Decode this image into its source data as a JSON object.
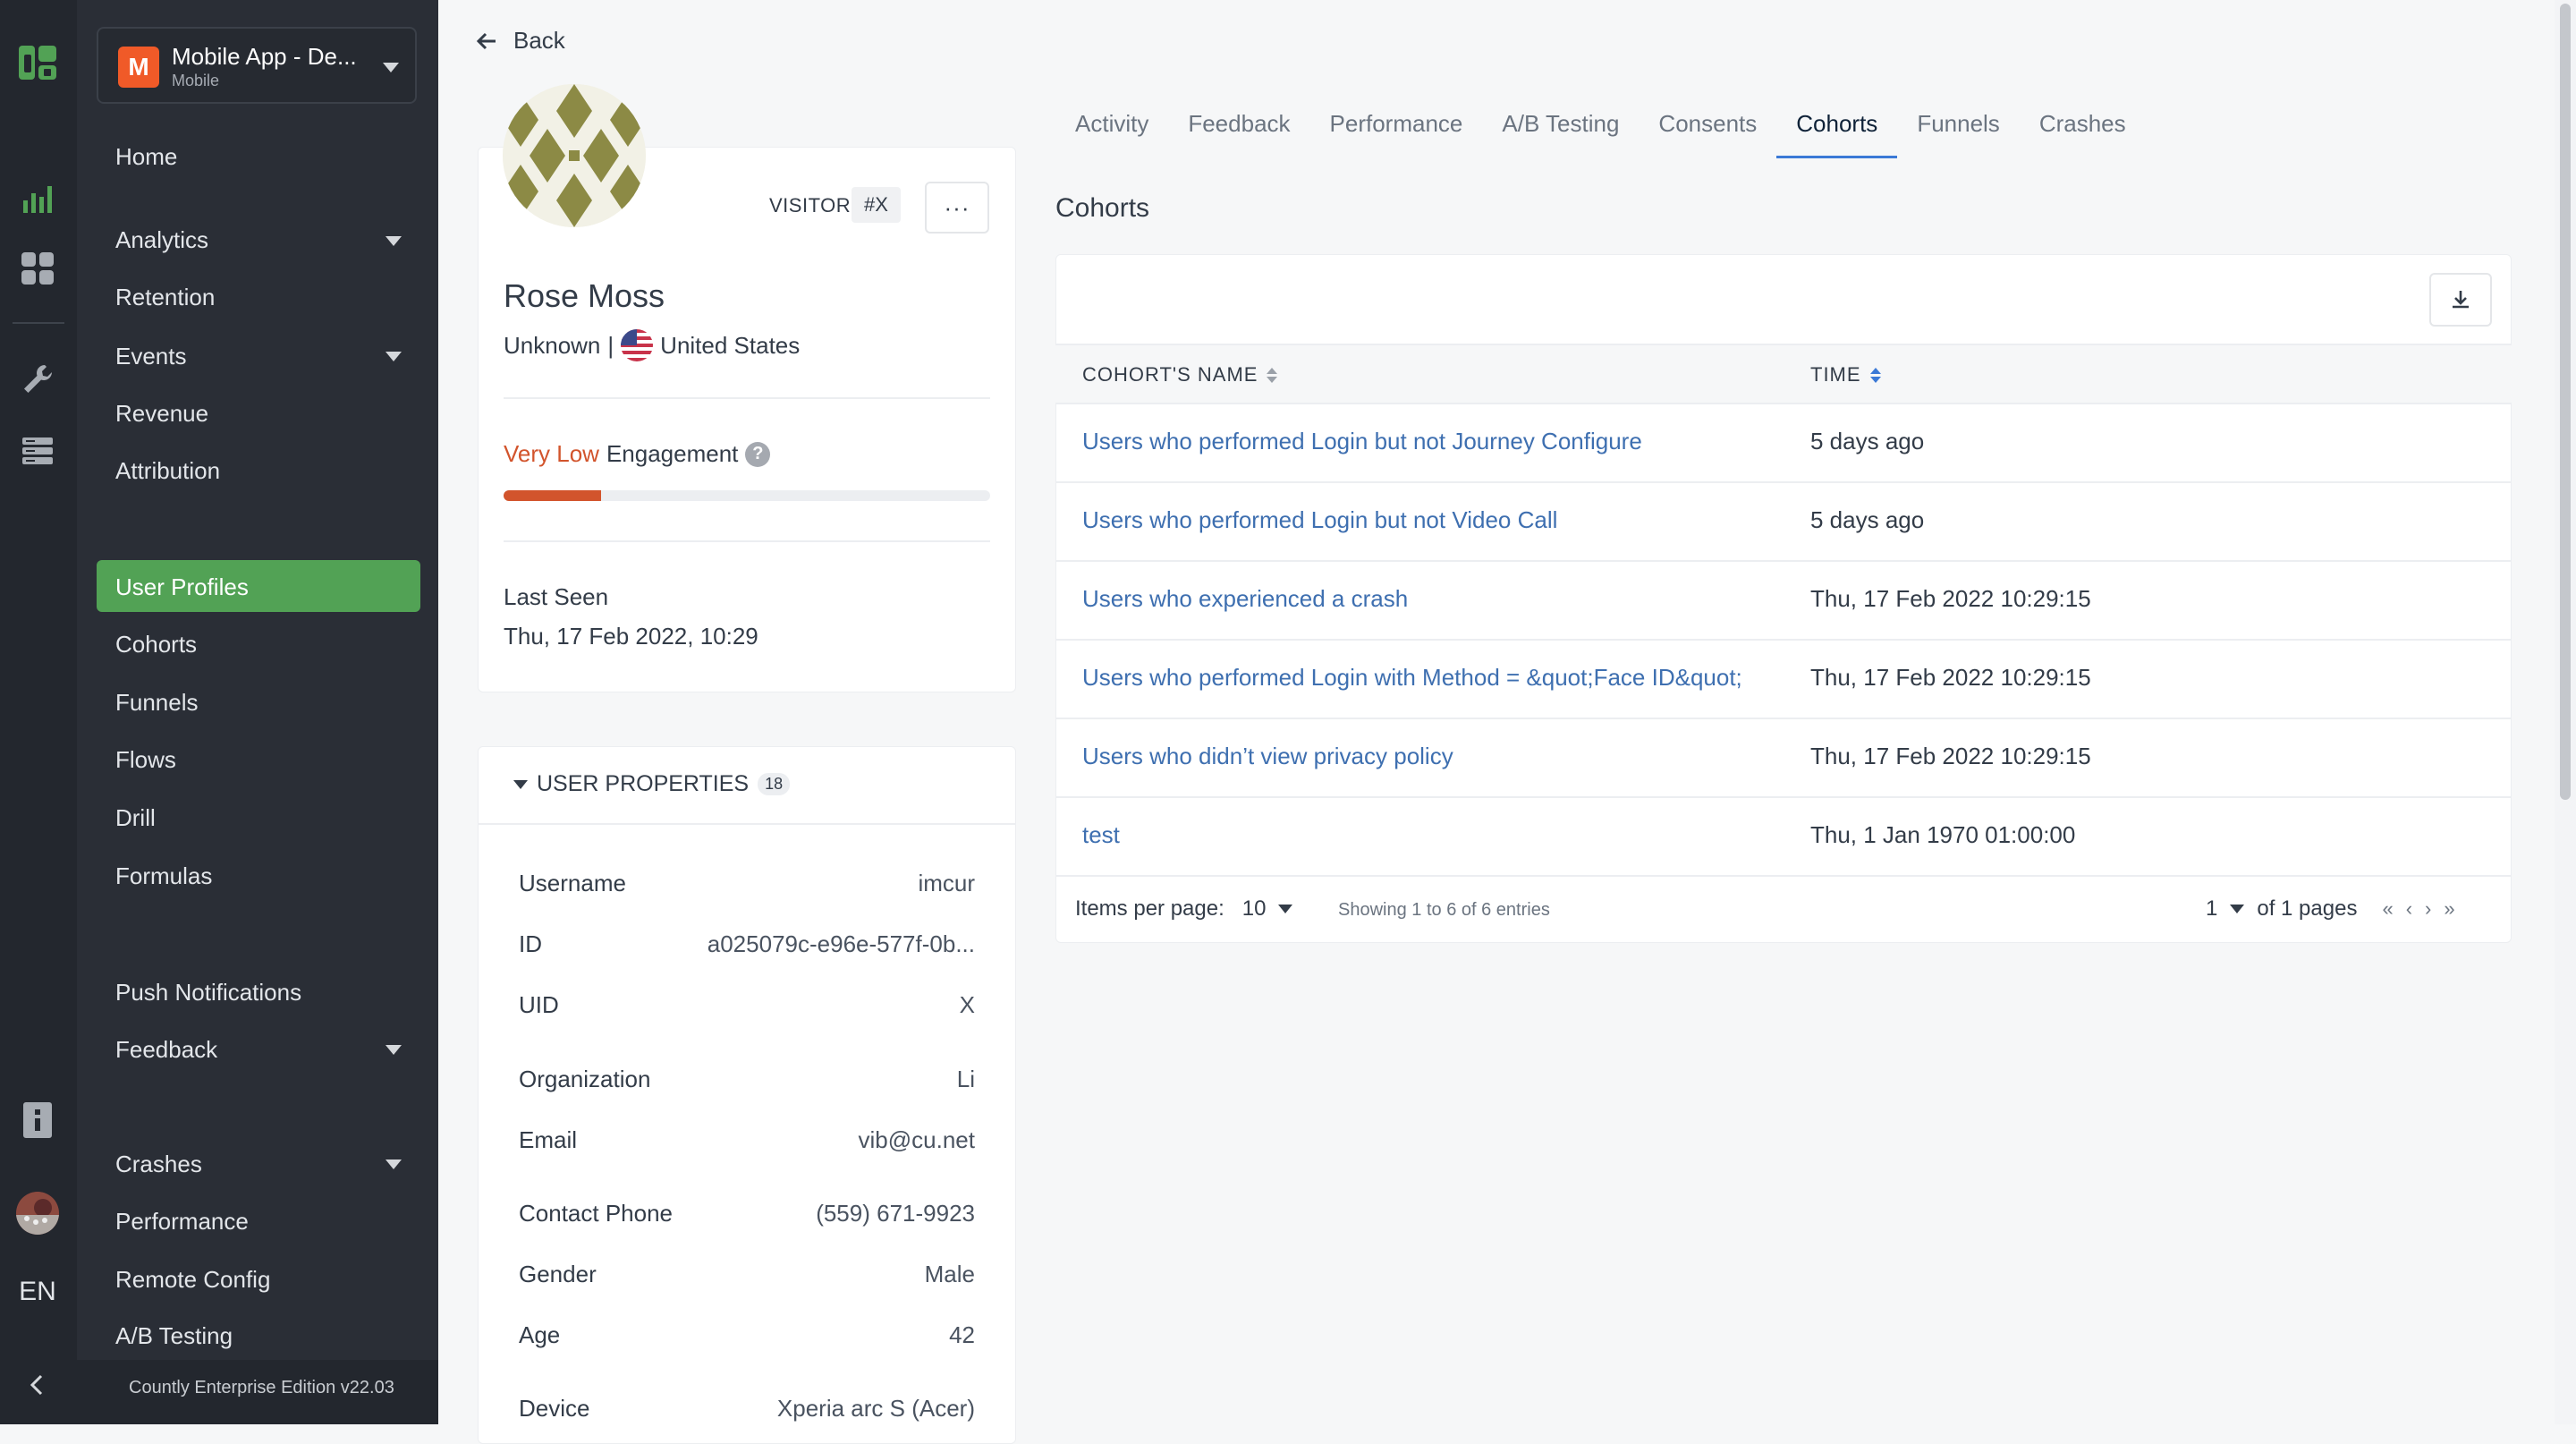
{
  "colors": {
    "rail_bg": "#23272e",
    "sidebar_bg": "#2a2e36",
    "active_nav": "#52a255",
    "accent_blue": "#3b79d6",
    "link_blue": "#3e6fb0",
    "engagement_low": "#d2542c",
    "app_badge": "#f05a28"
  },
  "rail": {
    "icons": [
      "countly-logo-icon",
      "analytics-bar-chart-icon",
      "dashboards-grid-icon",
      "management-wrench-icon",
      "data-manager-icon",
      "documentation-icon",
      "user-avatar",
      "collapse-sidebar-icon"
    ],
    "language": "EN"
  },
  "app_selector": {
    "badge": "M",
    "name": "Mobile App - De...",
    "type": "Mobile"
  },
  "nav": {
    "home": "Home",
    "analytics": "Analytics",
    "retention": "Retention",
    "events": "Events",
    "revenue": "Revenue",
    "attribution": "Attribution",
    "user_profiles": "User Profiles",
    "cohorts": "Cohorts",
    "funnels": "Funnels",
    "flows": "Flows",
    "drill": "Drill",
    "formulas": "Formulas",
    "push_notifications": "Push Notifications",
    "feedback": "Feedback",
    "crashes": "Crashes",
    "performance": "Performance",
    "remote_config": "Remote Config",
    "ab_testing": "A/B Testing"
  },
  "footer": {
    "edition": "Countly Enterprise Edition v22.03"
  },
  "back": {
    "label": "Back"
  },
  "profile": {
    "type_label": "VISITOR",
    "id_badge": "#X",
    "more_label": "···",
    "name": "Rose Moss",
    "org": "Unknown",
    "separator": "|",
    "country": "United States",
    "engagement_level": "Very Low",
    "engagement_word": "Engagement",
    "engagement_fraction": 0.2,
    "help_symbol": "?",
    "last_seen_label": "Last Seen",
    "last_seen_value": "Thu, 17 Feb 2022, 10:29"
  },
  "user_properties": {
    "title": "USER PROPERTIES",
    "count": "18",
    "rows": [
      {
        "key": "Username",
        "value": "imcur"
      },
      {
        "key": "ID",
        "value": "a025079c-e96e-577f-0b..."
      },
      {
        "key": "UID",
        "value": "X"
      },
      {
        "key": "Organization",
        "value": "Li"
      },
      {
        "key": "Email",
        "value": "vib@cu.net"
      },
      {
        "key": "Contact Phone",
        "value": "(559) 671-9923"
      },
      {
        "key": "Gender",
        "value": "Male"
      },
      {
        "key": "Age",
        "value": "42"
      },
      {
        "key": "Device",
        "value": "Xperia arc S (Acer)"
      }
    ]
  },
  "tabs": [
    {
      "label": "Activity",
      "active": false
    },
    {
      "label": "Feedback",
      "active": false
    },
    {
      "label": "Performance",
      "active": false
    },
    {
      "label": "A/B Testing",
      "active": false
    },
    {
      "label": "Consents",
      "active": false
    },
    {
      "label": "Cohorts",
      "active": true
    },
    {
      "label": "Funnels",
      "active": false
    },
    {
      "label": "Crashes",
      "active": false
    }
  ],
  "cohorts": {
    "title": "Cohorts",
    "columns": {
      "name": "COHORT'S NAME",
      "time": "TIME"
    },
    "rows": [
      {
        "name": "Users who performed Login but not Journey Configure",
        "time": "5 days ago"
      },
      {
        "name": "Users who performed Login but not Video Call",
        "time": "5 days ago"
      },
      {
        "name": "Users who experienced a crash",
        "time": "Thu, 17 Feb 2022 10:29:15"
      },
      {
        "name": "Users who performed Login with Method = &quot;Face ID&quot;",
        "time": "Thu, 17 Feb 2022 10:29:15"
      },
      {
        "name": "Users who didn’t view privacy policy",
        "time": "Thu, 17 Feb 2022 10:29:15"
      },
      {
        "name": "test",
        "time": "Thu, 1 Jan 1970 01:00:00"
      }
    ],
    "pagination": {
      "items_per_page_label": "Items per page:",
      "items_per_page": "10",
      "showing": "Showing 1 to 6 of 6 entries",
      "current_page": "1",
      "of_pages": "of 1 pages",
      "first": "«",
      "prev": "‹",
      "next": "›",
      "last": "»"
    }
  }
}
